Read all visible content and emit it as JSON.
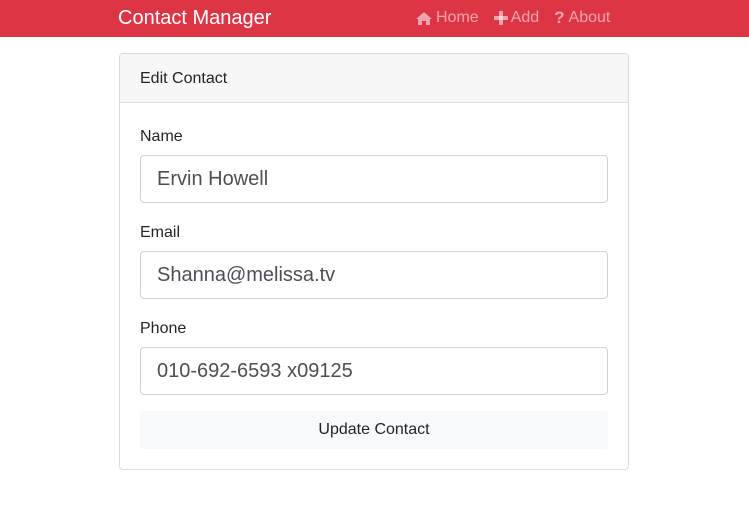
{
  "navbar": {
    "brand": "Contact Manager",
    "background_color": "#dc3545",
    "links": [
      {
        "label": "Home",
        "icon": "home-icon"
      },
      {
        "label": "Add",
        "icon": "plus-icon"
      },
      {
        "label": "About",
        "icon": "question-icon"
      }
    ]
  },
  "form": {
    "title": "Edit Contact",
    "fields": [
      {
        "label": "Name",
        "value": "Ervin Howell"
      },
      {
        "label": "Email",
        "value": "Shanna@melissa.tv"
      },
      {
        "label": "Phone",
        "value": "010-692-6593 x09125"
      }
    ],
    "submit_label": "Update Contact"
  }
}
